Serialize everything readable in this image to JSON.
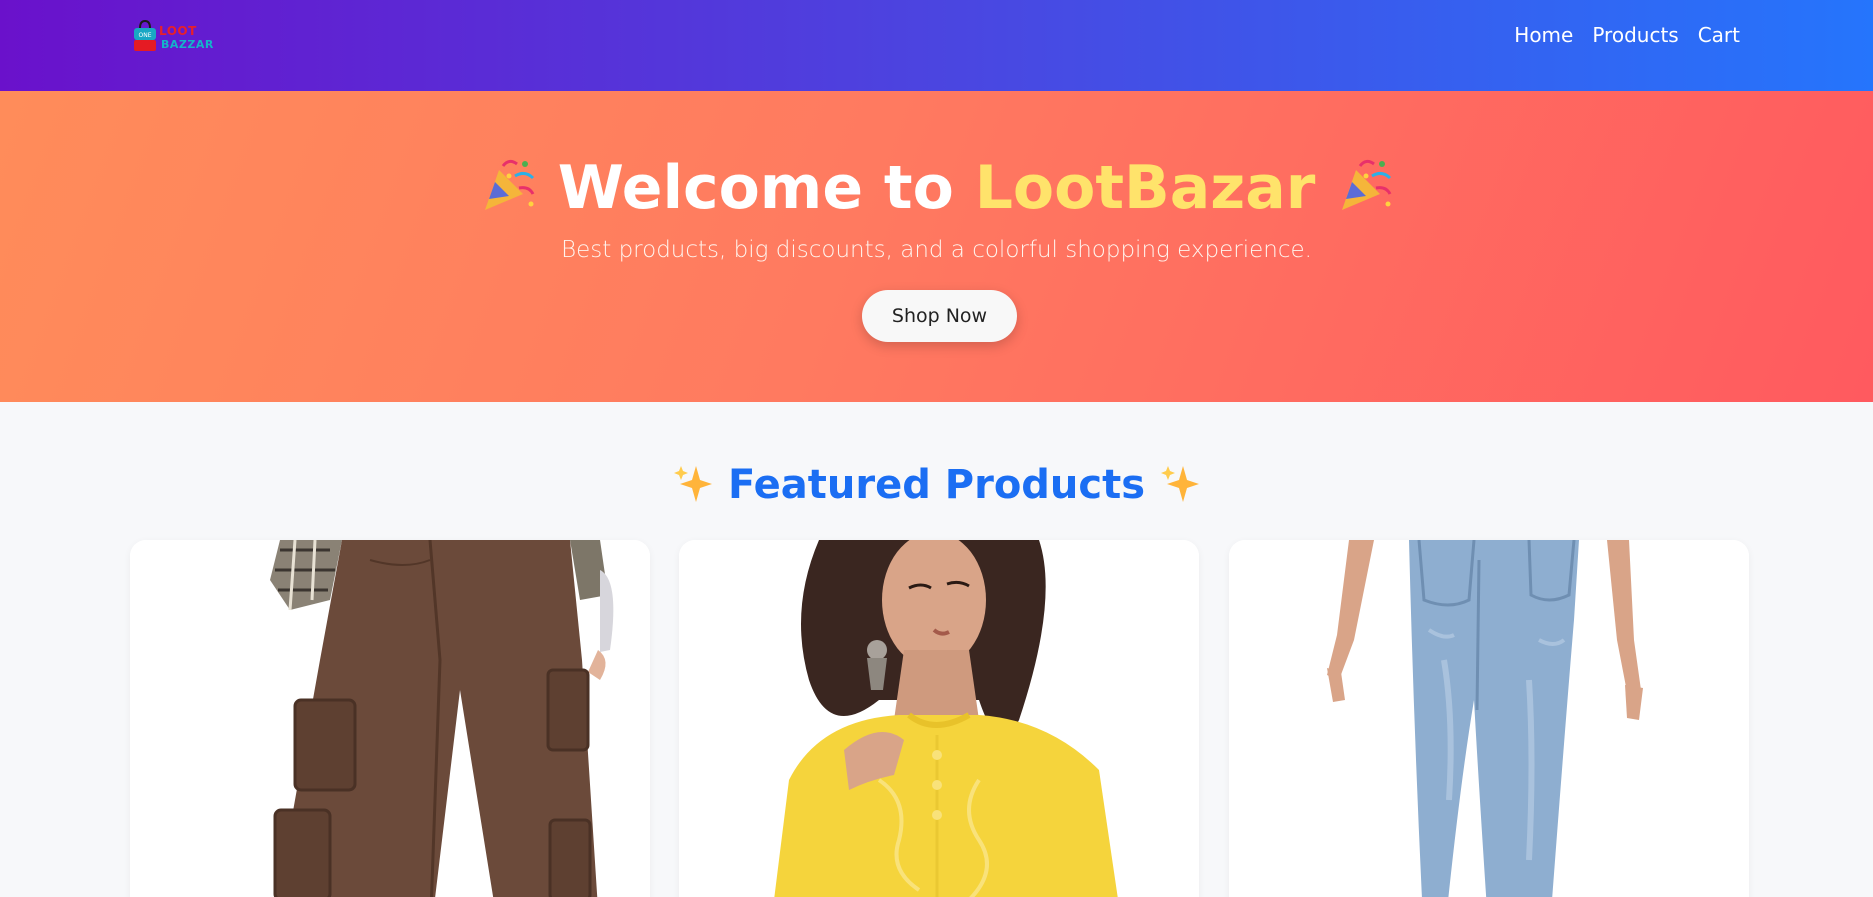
{
  "navbar": {
    "logo": {
      "line1": "LOOT",
      "line2": "BAZZAR"
    },
    "links": [
      "Home",
      "Products",
      "Cart"
    ]
  },
  "hero": {
    "title_prefix": "Welcome to ",
    "title_brand": "LootBazar",
    "subtitle": "Best products, big discounts, and a colorful shopping experience.",
    "cta_label": "Shop Now"
  },
  "featured": {
    "title": "Featured Products",
    "products": [
      {
        "image": "brown-cargo-pants"
      },
      {
        "image": "yellow-kurta"
      },
      {
        "image": "blue-jeans"
      }
    ]
  },
  "colors": {
    "nav_start": "#6a11cb",
    "nav_end": "#2575fc",
    "hero_start": "#ff8c5a",
    "hero_end": "#ff5a5f",
    "brand_yellow": "#ffe36b",
    "featured_blue": "#1b6ef3"
  }
}
